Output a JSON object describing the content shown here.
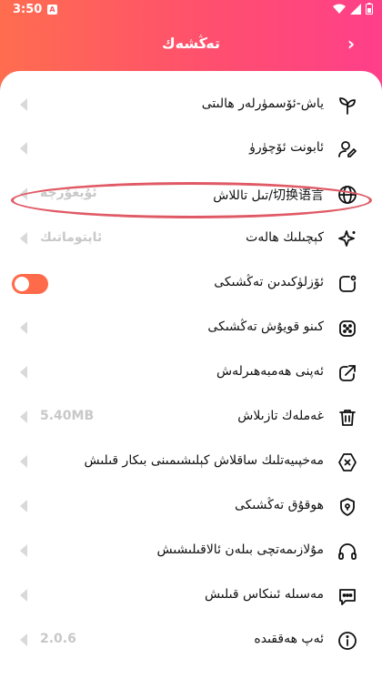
{
  "status_bar": {
    "time": "3:50",
    "notification_glyph": "A"
  },
  "header": {
    "title": "تەڭشەك",
    "back_label": "›"
  },
  "menu": {
    "items": [
      {
        "label": "ياش-ئۆسمۈرلەر ھالىتى",
        "icon": "sprout-icon",
        "value": ""
      },
      {
        "label": "ئابونت ئۆچۈرۈ",
        "icon": "user-edit-icon",
        "value": ""
      },
      {
        "label": "تىل تاللاش/切换语言",
        "icon": "globe-icon",
        "value": "ئۇيغۇرچە"
      },
      {
        "label": "كېچىلىك ھالەت",
        "icon": "sparkle-icon",
        "value": "ئاپتوماتىك"
      },
      {
        "label": "ئۆزلۈكىدىن تەڭشىكى",
        "icon": "rounded-square-icon",
        "value": "",
        "toggle": true
      },
      {
        "label": "كىنو قويۇش تەڭشىكى",
        "icon": "play-dots-icon",
        "value": ""
      },
      {
        "label": "ئەپنى ھەمبەھىرلەش",
        "icon": "share-icon",
        "value": ""
      },
      {
        "label": "غەملەك تازىلاش",
        "icon": "trash-icon",
        "value": "5.40MB"
      },
      {
        "label": "مەخپىيەتلىك ساقلاش كېلىشىمىنى بىكار قىلىش",
        "icon": "shield-x-icon",
        "value": ""
      },
      {
        "label": "ھوقۇق تەڭشىكى",
        "icon": "shield-lock-icon",
        "value": ""
      },
      {
        "label": "مۇلازىمەتچى بىلەن ئالاقىلىشىش",
        "icon": "headset-icon",
        "value": ""
      },
      {
        "label": "مەسىلە ئىنكاس قىلىش",
        "icon": "chat-icon",
        "value": ""
      },
      {
        "label": "ئەپ ھەققىدە",
        "icon": "info-icon",
        "value": "2.0.6"
      }
    ]
  },
  "colors": {
    "accent": "#ff6a4a",
    "highlight": "#e05a66"
  }
}
